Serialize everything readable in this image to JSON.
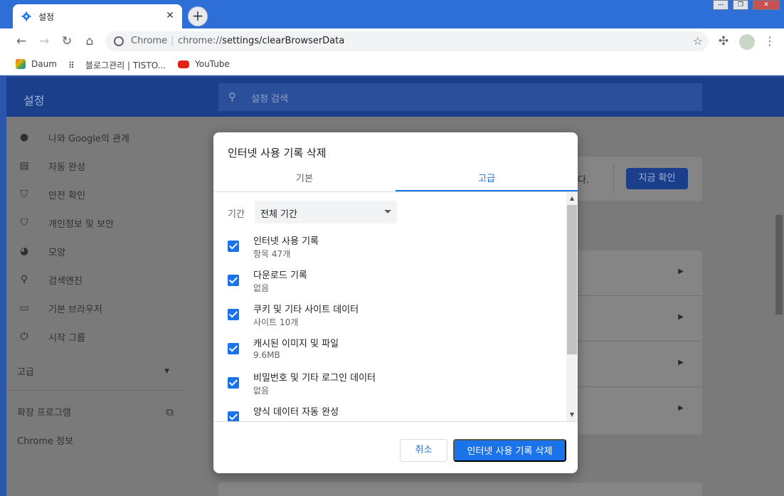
{
  "browser": {
    "tab_title": "설정",
    "tab_close": "✕",
    "new_tab": "+",
    "omnibox_site": "Chrome",
    "omnibox_separator": "|",
    "omnibox_url_prefix": "chrome://",
    "omnibox_url_path": "settings/clearBrowserData",
    "window_controls": [
      "—",
      "❐",
      "✕"
    ]
  },
  "bookmarks": [
    {
      "label": "Daum"
    },
    {
      "label": "블로그관리 | TISTO..."
    },
    {
      "label": "YouTube"
    }
  ],
  "settings": {
    "title": "설정",
    "search_placeholder": "설정 검색",
    "sidebar": [
      {
        "label": "나와 Google의 관계",
        "icon": "person-icon"
      },
      {
        "label": "자동 완성",
        "icon": "clipboard-icon"
      },
      {
        "label": "안전 확인",
        "icon": "shield-check-icon"
      },
      {
        "label": "개인정보 및 보안",
        "icon": "shield-icon"
      },
      {
        "label": "모양",
        "icon": "palette-icon"
      },
      {
        "label": "검색엔진",
        "icon": "search-icon"
      },
      {
        "label": "기본 브라우저",
        "icon": "browser-icon"
      },
      {
        "label": "시작 그룹",
        "icon": "power-icon"
      }
    ],
    "advanced": "고급",
    "extensions": "확장 프로그램",
    "about": "Chrome 정보",
    "confirm_button": "지금 확인",
    "bg_card_text_fragment": "다."
  },
  "dialog": {
    "title": "인터넷 사용 기록 삭제",
    "tabs": [
      "기본",
      "고급"
    ],
    "active_tab": "고급",
    "range_label": "기간",
    "range_value": "전체 기간",
    "items": [
      {
        "label": "인터넷 사용 기록",
        "sub": "항목 47개",
        "checked": true
      },
      {
        "label": "다운로드 기록",
        "sub": "없음",
        "checked": true
      },
      {
        "label": "쿠키 및 기타 사이트 데이터",
        "sub": "사이트 10개",
        "checked": true
      },
      {
        "label": "캐시된 이미지 및 파일",
        "sub": "9.6MB",
        "checked": true
      },
      {
        "label": "비밀번호 및 기타 로그인 데이터",
        "sub": "없음",
        "checked": true
      },
      {
        "label": "양식 데이터 자동 완성",
        "sub": "",
        "checked": true
      }
    ],
    "cancel_label": "취소",
    "delete_label": "인터넷 사용 기록 삭제"
  },
  "colors": {
    "accent": "#1a73e8",
    "header": "#2d6fd6"
  }
}
